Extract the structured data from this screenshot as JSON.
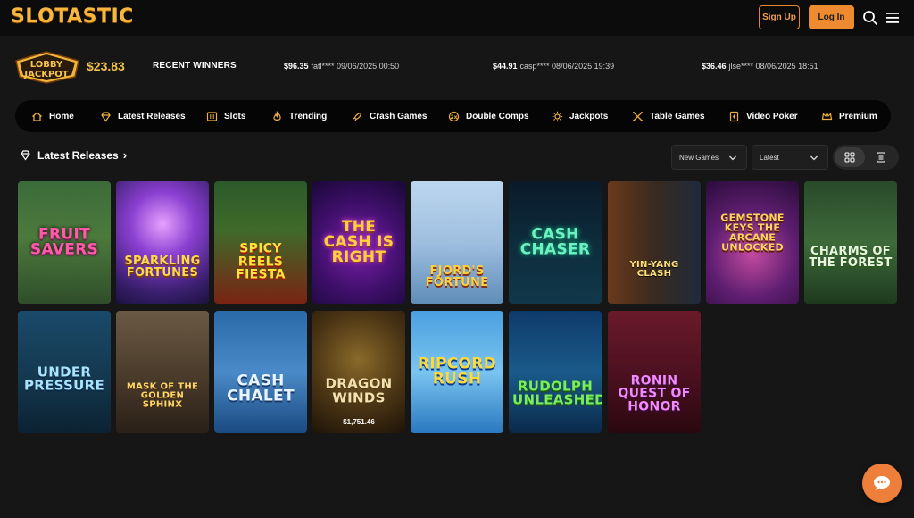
{
  "header": {
    "logo": "SLOTASTIC",
    "signup_label": "Sign Up",
    "login_label": "Log In"
  },
  "winners_bar": {
    "jackpot_badge_line1": "LOBBY",
    "jackpot_badge_line2": "JACKPOT",
    "jackpot_amount": "$23.83",
    "recent_label": "RECENT WINNERS",
    "entries": [
      {
        "amount": "$96.35",
        "detail": "fatl**** 09/06/2025 00:50"
      },
      {
        "amount": "$44.91",
        "detail": "casp**** 08/06/2025 19:39"
      },
      {
        "amount": "$36.46",
        "detail": "jlse**** 08/06/2025 18:51"
      }
    ]
  },
  "nav": [
    {
      "label": "Home",
      "icon": "home-icon"
    },
    {
      "label": "Latest Releases",
      "icon": "diamond-icon"
    },
    {
      "label": "Slots",
      "icon": "slot-machine-icon"
    },
    {
      "label": "Trending",
      "icon": "flame-icon"
    },
    {
      "label": "Crash Games",
      "icon": "rocket-icon"
    },
    {
      "label": "Double Comps",
      "icon": "coin-icon"
    },
    {
      "label": "Jackpots",
      "icon": "sparkle-icon"
    },
    {
      "label": "Table Games",
      "icon": "cards-icon"
    },
    {
      "label": "Video Poker",
      "icon": "poker-card-icon"
    },
    {
      "label": "Premium",
      "icon": "crown-icon"
    }
  ],
  "section": {
    "title": "Latest Releases",
    "filter_category": "New Games",
    "filter_sort": "Latest"
  },
  "games": [
    {
      "name": "Fruit Savers"
    },
    {
      "name": "Sparkling Fortunes"
    },
    {
      "name": "Spicy Reels Fiesta"
    },
    {
      "name": "The Cash is Right"
    },
    {
      "name": "Fjord's Fortune"
    },
    {
      "name": "Cash Chaser"
    },
    {
      "name": "Yin-Yang Clash"
    },
    {
      "name": "Gemstone Keys The Arcane Unlocked"
    },
    {
      "name": "Charms of the Forest"
    },
    {
      "name": "Under Pressure"
    },
    {
      "name": "Mask of the Golden Sphinx"
    },
    {
      "name": "Cash Chalet"
    },
    {
      "name": "Dragon Winds",
      "jackpot": "$1,751.46"
    },
    {
      "name": "Ripcord Rush"
    },
    {
      "name": "Rudolph Unleashed"
    },
    {
      "name": "Ronin Quest of Honor"
    }
  ],
  "colors": {
    "accent": "#ee8a2f",
    "gold": "#f3c04a",
    "background": "#161616"
  }
}
